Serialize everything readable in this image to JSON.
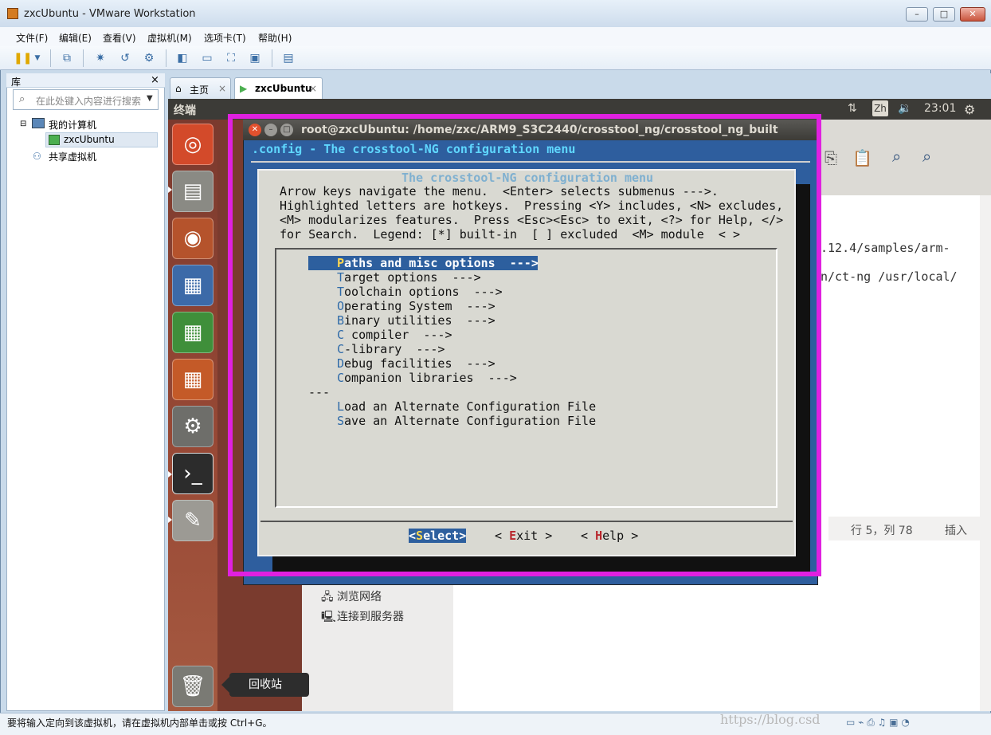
{
  "window": {
    "title": "zxcUbuntu - VMware Workstation",
    "min": "–",
    "max": "□",
    "close": "✕"
  },
  "menubar": [
    "文件(F)",
    "编辑(E)",
    "查看(V)",
    "虚拟机(M)",
    "选项卡(T)",
    "帮助(H)"
  ],
  "library": {
    "title": "库",
    "close": "×",
    "search_placeholder": "在此处键入内容进行搜索",
    "tree": [
      "我的计算机",
      "zxcUbuntu",
      "共享虚拟机"
    ]
  },
  "tabs": [
    {
      "label": "主页",
      "close": "×"
    },
    {
      "label": "zxcUbuntu",
      "close": "×"
    }
  ],
  "unity": {
    "panel_label": "终端",
    "lang": "Zh",
    "clock": "23:01",
    "trash_tooltip": "回收站"
  },
  "background": {
    "path1": ".12.4/samples/arm-",
    "path2": "n/ct-ng /usr/local/",
    "rowcol": "行 5，列 78",
    "insert": "插入",
    "browse": "浏览网络",
    "connect": "连接到服务器"
  },
  "terminal": {
    "title": "root@zxcUbuntu: /home/zxc/ARM9_S3C2440/crosstool_ng/crosstool_ng_built",
    "header": ".config - The crosstool-NG configuration menu",
    "dialog_title": "The crosstool-NG configuration menu",
    "help": [
      "Arrow keys navigate the menu.  <Enter> selects submenus --->.",
      "Highlighted letters are hotkeys.  Pressing <Y> includes, <N> excludes,",
      "<M> modularizes features.  Press <Esc><Esc> to exit, <?> for Help, </>",
      "for Search.  Legend: [*] built-in  [ ] excluded  <M> module  < >"
    ],
    "selected": {
      "hot": "P",
      "rest": "aths and misc options  --->"
    },
    "items": [
      {
        "hot": "T",
        "rest": "arget options  --->"
      },
      {
        "hot": "T",
        "rest": "oolchain options  --->"
      },
      {
        "hot": "O",
        "rest": "perating System  --->"
      },
      {
        "hot": "B",
        "rest": "inary utilities  --->"
      },
      {
        "hot": "C",
        "rest": " compiler  --->"
      },
      {
        "hot": "C",
        "rest": "-library  --->"
      },
      {
        "hot": "D",
        "rest": "ebug facilities  --->"
      },
      {
        "hot": "C",
        "rest": "ompanion libraries  --->"
      }
    ],
    "separator": "---",
    "extra": [
      {
        "hot": "L",
        "rest": "oad an Alternate Configuration File"
      },
      {
        "hot": "S",
        "rest": "ave an Alternate Configuration File"
      }
    ],
    "buttons": {
      "select_hot": "S",
      "select_rest": "elect",
      "exit_pre": "< ",
      "exit_hot": "E",
      "exit_rest": "xit >",
      "help_pre": "< ",
      "help_hot": "H",
      "help_rest": "elp >",
      "lt": "<",
      "gt": ">"
    }
  },
  "statusbar": {
    "text": "要将输入定向到该虚拟机，请在虚拟机内部单击或按 Ctrl+G。",
    "watermark": "https://blog.csd"
  },
  "colors": {
    "highlight": "#e020e0",
    "dialog": "#d9d9d2",
    "terminal": "#2e5e9e",
    "hotkey_blue": "#2e6aa8",
    "hotkey_red": "#b8262c"
  }
}
